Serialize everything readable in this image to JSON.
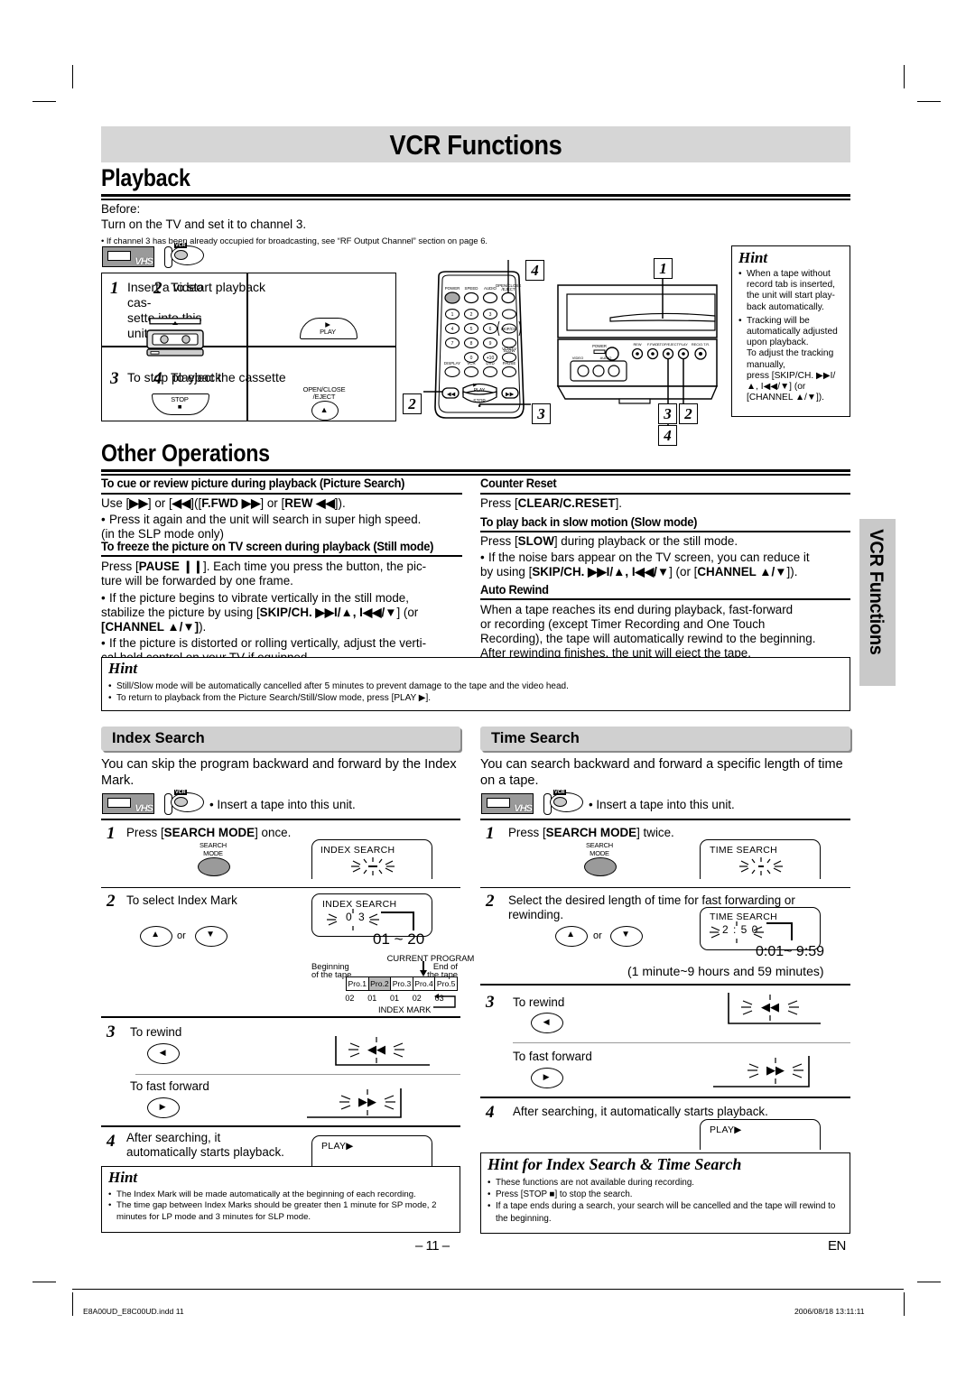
{
  "header": {
    "banner_title": "VCR Functions",
    "section_playback": "Playback"
  },
  "playback": {
    "before_label": "Before:",
    "before_line": "Turn on the TV and set it to channel 3.",
    "before_note": "• If channel 3 has been already occupied for broadcasting, see “RF Output Channel” section on page 6.",
    "steps": [
      {
        "num": "1",
        "text": "Insert a video cas-\nsette into this unit.",
        "button": ""
      },
      {
        "num": "2",
        "text": "To start playback",
        "button": "PLAY"
      },
      {
        "num": "3",
        "text": "To stop playback",
        "button": "STOP"
      },
      {
        "num": "4",
        "text": "To eject the cassette",
        "button": "OPEN/CLOSE\n/EJECT"
      }
    ],
    "callouts": [
      "1",
      "2",
      "3",
      "4"
    ],
    "hint": {
      "title": "Hint",
      "items": [
        "When a tape without record tab is inserted, the unit will start play-back automatically.",
        "Tracking will be automatically adjusted upon playback.\nTo adjust the tracking manually,\npress [SKIP/CH. ▶▶I/▲, I◀◀/▼] (or [CHANNEL ▲/▼])."
      ]
    }
  },
  "remote": {
    "top_row": [
      "POWER",
      "SPEED",
      "AUDIO",
      "OPEN/CLOSE\n/EJECT"
    ],
    "keys": [
      "1",
      "2",
      "3",
      "4",
      "5",
      "6",
      "7",
      "8",
      "9",
      "0",
      "+10"
    ],
    "side_labels": [
      "SKIP/CH.",
      "VCR/TV",
      "SLOW",
      "PAUSE"
    ],
    "bottom_row": [
      "DISPLAY",
      "VCR",
      "DVD",
      "PAUSE"
    ],
    "transport": [
      "PLAY",
      "STOP"
    ]
  },
  "vcr_panel": {
    "front_buttons": [
      "REW",
      "F.FWD",
      "STOP/EJECT",
      "PLAY",
      "REC/O.T.R."
    ],
    "power_label": "POWER",
    "jack_labels": [
      "VIDEO",
      "AUDIO"
    ]
  },
  "other_operations": {
    "title": "Other Operations",
    "left": [
      {
        "head": "To cue or review picture during playback (Picture Search)",
        "lines": [
          {
            "type": "p",
            "html": "Use [<b>▶▶</b>] or [<b>◀◀</b>]([<b>F.FWD ▶▶</b>] or [<b>REW ◀◀</b>])."
          },
          {
            "type": "li",
            "html": "Press it again and the unit will search in super high speed. (in the SLP mode only)"
          }
        ]
      },
      {
        "head": "To freeze the picture on TV screen during playback (Still mode)",
        "lines": [
          {
            "type": "p",
            "html": "Press [<b>PAUSE ▐▐</b>]. Each time you press the button, the pic-ture will be forwarded by one frame."
          },
          {
            "type": "li",
            "html": "If the picture begins to vibrate vertically in the still mode, stabilize the picture by using [<b>SKIP/CH. ▶▶I/▲, I◀◀/▼</b>] (or [<b>CHANNEL ▲/▼</b>])."
          },
          {
            "type": "li",
            "html": "If the picture is distorted or rolling vertically, adjust the verti-cal hold control on your TV if equipped."
          }
        ]
      }
    ],
    "right": [
      {
        "head": "Counter Reset",
        "lines": [
          {
            "type": "p",
            "html": "Press [<b>CLEAR/C.RESET</b>]."
          }
        ]
      },
      {
        "head": "To play back in slow motion (Slow mode)",
        "lines": [
          {
            "type": "p",
            "html": "Press [<b>SLOW</b>] during playback or the still mode."
          },
          {
            "type": "li",
            "html": "If the noise bars appear on the TV screen, you can reduce it by using [<b>SKIP/CH. ▶▶I/▲, I◀◀/▼</b>] (or [<b>CHANNEL ▲/▼</b>])."
          }
        ]
      },
      {
        "head": "Auto Rewind",
        "lines": [
          {
            "type": "p",
            "html": "When a tape reaches its end during playback, fast-forward or recording (except Timer Recording and One Touch Recording), the tape will automatically rewind to the beginning. After rewinding finishes, the unit will eject the tape."
          }
        ]
      }
    ],
    "hint": {
      "title": "Hint",
      "items": [
        "Still/Slow mode will be automatically cancelled after 5 minutes to prevent damage to the tape and the video head.",
        "To return to playback from the Picture Search/Still/Slow mode, press [PLAY ▶]."
      ]
    }
  },
  "index_search": {
    "title": "Index Search",
    "intro": "You can skip the program backward and forward by the Index Mark.",
    "insert_note": "• Insert a tape into this unit.",
    "steps": [
      {
        "num": "1",
        "text": "Press [SEARCH MODE] once.",
        "button_label": "SEARCH\nMODE",
        "display": "INDEX SEARCH"
      },
      {
        "num": "2",
        "text": "To select Index Mark",
        "button_label": "",
        "display": "INDEX SEARCH",
        "display_value": "0 3",
        "range": "01 ~ 20"
      },
      {
        "num": "3",
        "text": "To rewind",
        "text2": "To fast forward"
      },
      {
        "num": "4",
        "text": "After searching, it automatically starts playback.",
        "display": "PLAY▶"
      }
    ],
    "timeline": {
      "current_label": "CURRENT PROGRAM",
      "begin_label": "Beginning\nof the tape",
      "end_label": "End of\nthe tape",
      "programs": [
        "Pro.1",
        "Pro.2",
        "Pro.3",
        "Pro.4",
        "Pro.5"
      ],
      "marks": [
        "02",
        "01",
        "01",
        "02",
        "03"
      ],
      "mark_label": "INDEX MARK",
      "highlight_index": 1
    },
    "hint": {
      "title": "Hint",
      "items": [
        "The Index Mark will be made automatically at the beginning of each recording.",
        "The time gap between Index Marks should be greater then 1 minute for SP mode, 2 minutes for LP mode and 3 minutes for SLP mode."
      ]
    }
  },
  "time_search": {
    "title": "Time Search",
    "intro": "You can search backward and forward a specific length of time on a tape.",
    "insert_note": "• Insert a tape into this unit.",
    "steps": [
      {
        "num": "1",
        "text": "Press [SEARCH MODE] twice.",
        "button_label": "SEARCH\nMODE",
        "display": "TIME SEARCH"
      },
      {
        "num": "2",
        "text": "Select the desired length of time for fast forwarding or rewinding.",
        "display": "TIME SEARCH",
        "display_value": "2 : 5 0",
        "range": "0:01~ 9:59",
        "range_note": "(1 minute~9 hours and 59 minutes)"
      },
      {
        "num": "3",
        "text": "To rewind",
        "text2": "To fast forward"
      },
      {
        "num": "4",
        "text": "After searching, it automatically starts playback.",
        "display": "PLAY▶"
      }
    ],
    "or_label": "or"
  },
  "combined_hint": {
    "title": "Hint for Index Search & Time Search",
    "items": [
      "These functions are not available during recording.",
      "Press [STOP ■] to stop the search.",
      "If a tape ends during a search, your search will be cancelled and the tape will rewind to the beginning."
    ]
  },
  "sidetab": {
    "label": "VCR Functions"
  },
  "footer": {
    "page": "– 11 –",
    "lang": "EN",
    "file": "E8A00UD_E8C00UD.indd   11",
    "timestamp": "2006/08/18   13:11:11"
  }
}
